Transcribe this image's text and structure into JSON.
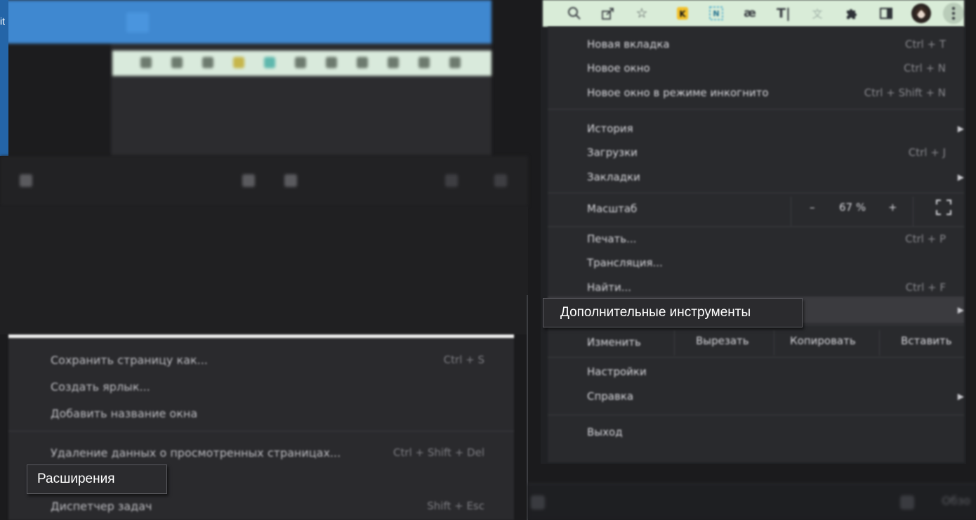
{
  "background": {
    "left_edge_text": "it",
    "top_tabs": [
      "",
      ""
    ],
    "toolbar_items": [
      "",
      "",
      "",
      ""
    ],
    "mini_menu": [
      {
        "label": "",
        "shortcut": ""
      },
      {
        "label": "",
        "shortcut": ""
      },
      {
        "label": "",
        "shortcut": ""
      }
    ]
  },
  "left_menu": {
    "items": [
      {
        "label": "Сохранить страницу как...",
        "shortcut": "Ctrl + S"
      },
      {
        "label": "Создать ярлык...",
        "shortcut": ""
      },
      {
        "label": "Добавить название окна",
        "shortcut": ""
      },
      {
        "label": "Удаление данных о просмотренных страницах...",
        "shortcut": "Ctrl + Shift + Del"
      },
      {
        "label": "Диспетчер задач",
        "shortcut": "Shift + Esc"
      }
    ],
    "tooltip": "Расширения"
  },
  "chrome": {
    "toolbar_icons": [
      "search-icon",
      "share-icon",
      "star-icon",
      "extension-k-icon",
      "extension-n-icon",
      "extension-ae-icon",
      "text-tool-icon",
      "translate-icon",
      "puzzle-icon",
      "sidebar-icon",
      "avatar",
      "kebab-menu-icon"
    ],
    "menu": {
      "new_tab": {
        "label": "Новая вкладка",
        "shortcut": "Ctrl + T"
      },
      "new_window": {
        "label": "Новое окно",
        "shortcut": "Ctrl + N"
      },
      "incognito": {
        "label": "Новое окно в режиме инкогнито",
        "shortcut": "Ctrl + Shift + N"
      },
      "history": {
        "label": "История"
      },
      "downloads": {
        "label": "Загрузки",
        "shortcut": "Ctrl + J"
      },
      "bookmarks": {
        "label": "Закладки"
      },
      "zoom": {
        "label": "Масштаб",
        "minus": "–",
        "value": "67 %",
        "plus": "+"
      },
      "print": {
        "label": "Печать...",
        "shortcut": "Ctrl + P"
      },
      "cast": {
        "label": "Трансляция..."
      },
      "find": {
        "label": "Найти...",
        "shortcut": "Ctrl + F"
      },
      "more_tools": {
        "label": "Дополнительные инструменты"
      },
      "edit": {
        "label": "Изменить",
        "cut": "Вырезать",
        "copy": "Копировать",
        "paste": "Вставить"
      },
      "settings": {
        "label": "Настройки"
      },
      "help": {
        "label": "Справка"
      },
      "exit": {
        "label": "Выход"
      }
    },
    "tooltip": "Дополнительные инструменты"
  },
  "bottom_bar": {
    "text": "Обзо"
  },
  "colors": {
    "menu_bg": "#292a2d",
    "toolbar_bg": "#d9ecd8",
    "tooltip_border": "#5b5b60"
  }
}
